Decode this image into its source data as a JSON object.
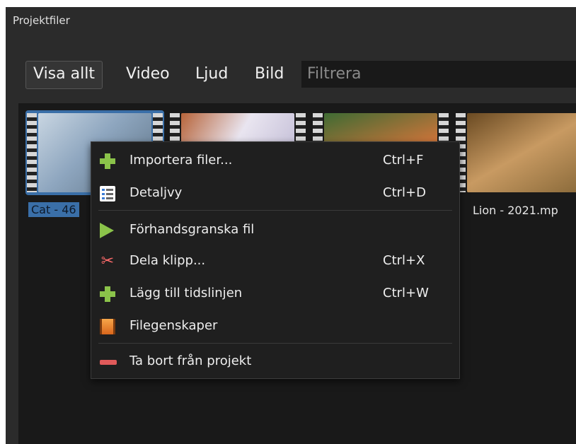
{
  "panel": {
    "title": "Projektfiler"
  },
  "filters": {
    "buttons": [
      "Visa allt",
      "Video",
      "Ljud",
      "Bild"
    ],
    "active": "Visa allt",
    "placeholder": "Filtrera"
  },
  "files": [
    {
      "label": "Cat - 46",
      "selected": true
    },
    {
      "label": "",
      "selected": false
    },
    {
      "label": "",
      "selected": false
    },
    {
      "label": "Lion - 2021.mp",
      "selected": false
    }
  ],
  "context_menu": {
    "items": [
      {
        "label": "Importera filer...",
        "shortcut": "Ctrl+F",
        "icon": "plus-icon"
      },
      {
        "label": "Detaljvy",
        "shortcut": "Ctrl+D",
        "icon": "details-view-icon"
      },
      {
        "label": "Förhandsgranska fil",
        "shortcut": "",
        "icon": "play-icon"
      },
      {
        "label": "Dela klipp...",
        "shortcut": "Ctrl+X",
        "icon": "scissors-icon"
      },
      {
        "label": "Lägg till tidslinjen",
        "shortcut": "Ctrl+W",
        "icon": "plus-icon"
      },
      {
        "label": "Filegenskaper",
        "shortcut": "",
        "icon": "film-icon"
      },
      {
        "label": "Ta bort från projekt",
        "shortcut": "",
        "icon": "minus-icon"
      }
    ]
  },
  "colors": {
    "panel_bg": "#2b2b2b",
    "files_bg": "#191919",
    "selection": "#3a6fa8",
    "plus_green": "#8bc34a",
    "remove_red": "#e05a5a"
  }
}
